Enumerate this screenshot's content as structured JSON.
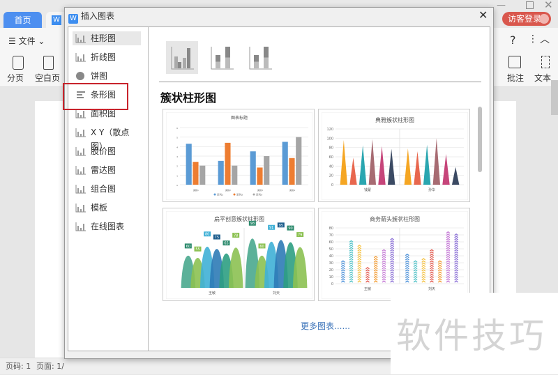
{
  "app": {
    "tabs": [
      {
        "label": "首页"
      },
      {
        "label": "W"
      }
    ],
    "login": "访客登录",
    "toolbar": {
      "file": "文件",
      "page_break": "分页",
      "blank_page": "空白页",
      "comment": "批注",
      "text": "文本",
      "help": "?"
    },
    "status": {
      "page_num": "页码: 1",
      "page": "页面: 1/"
    }
  },
  "dialog": {
    "title": "插入图表",
    "logo": "W",
    "categories": [
      {
        "label": "柱形图",
        "icon": "bar-chart-icon",
        "selected": true
      },
      {
        "label": "折线图",
        "icon": "line-chart-icon"
      },
      {
        "label": "饼图",
        "icon": "pie-chart-icon"
      },
      {
        "label": "条形图",
        "icon": "horizontal-bar-icon",
        "highlighted": true
      },
      {
        "label": "面积图",
        "icon": "area-chart-icon"
      },
      {
        "label": "X Y（散点图）",
        "icon": "scatter-icon"
      },
      {
        "label": "股价图",
        "icon": "stock-chart-icon"
      },
      {
        "label": "雷达图",
        "icon": "radar-chart-icon"
      },
      {
        "label": "组合图",
        "icon": "combo-chart-icon"
      },
      {
        "label": "模板",
        "icon": "template-icon"
      },
      {
        "label": "在线图表",
        "icon": "online-chart-icon"
      }
    ],
    "subtypes": [
      "clustered-column",
      "stacked-column",
      "percent-stacked-column"
    ],
    "heading": "簇状柱形图",
    "previews": [
      {
        "title": "图表标题",
        "type": "bar",
        "categories": [
          "类别1",
          "类别2",
          "类别3",
          "类别4"
        ],
        "ylim": [
          0,
          6
        ],
        "yticks": [
          0,
          1,
          2,
          3,
          4,
          5,
          6
        ],
        "series": [
          {
            "name": "系列1",
            "color": "#5b9bd5",
            "values": [
              4.3,
              2.5,
              3.5,
              4.5
            ]
          },
          {
            "name": "系列2",
            "color": "#ed7d31",
            "values": [
              2.4,
              4.4,
              1.8,
              2.8
            ]
          },
          {
            "name": "系列3",
            "color": "#a5a5a5",
            "values": [
              2,
              2,
              3,
              5
            ]
          }
        ]
      },
      {
        "title": "典雅簇状柱形图",
        "type": "cone",
        "categories": [
          "钱蒙",
          "孙华"
        ],
        "ylim": [
          0,
          120
        ],
        "yticks": [
          0,
          20,
          40,
          60,
          80,
          100,
          120
        ],
        "colors": [
          "#f5a623",
          "#e8674e",
          "#2aa6b0",
          "#a76b72",
          "#c6457a",
          "#3b4a63"
        ],
        "values": [
          [
            96,
            58,
            85,
            98,
            83,
            77
          ],
          [
            78,
            72,
            86,
            100,
            66,
            38
          ]
        ]
      },
      {
        "title": "扁平创意簇状柱形图",
        "type": "hill",
        "categories": [
          "王敏",
          "刘天"
        ],
        "ylim": [
          0,
          100
        ],
        "colors": [
          "#4aa98e",
          "#8cc152",
          "#3fb0d6",
          "#2d7bb6",
          "#2e9e82",
          "#8cc152"
        ],
        "labelColors": [
          "#2e8b6e",
          "#8cc152",
          "#3fb0d6",
          "#1f5f8e",
          "#2e8b6e",
          "#8cc152"
        ],
        "values": [
          [
            60,
            55,
            80,
            75,
            65,
            78
          ],
          [
            98,
            60,
            91,
            95,
            90,
            79
          ]
        ]
      },
      {
        "title": "商务箭头簇状柱形图",
        "type": "arrow",
        "categories": [
          "王敏",
          "刘天"
        ],
        "ylim": [
          0,
          80
        ],
        "yticks": [
          0,
          10,
          20,
          30,
          40,
          50,
          60,
          70,
          80
        ],
        "colors": [
          "#4a90d9",
          "#4fc1c6",
          "#f5c242",
          "#e2574c",
          "#f39c33",
          "#c57ad6",
          "#8a6fd6"
        ],
        "values": [
          [
            31,
            61,
            54,
            24,
            40,
            49,
            66
          ],
          [
            41,
            32,
            36,
            49,
            33,
            75,
            72
          ]
        ]
      }
    ],
    "more": "更多图表......"
  },
  "watermark": "软件技巧"
}
